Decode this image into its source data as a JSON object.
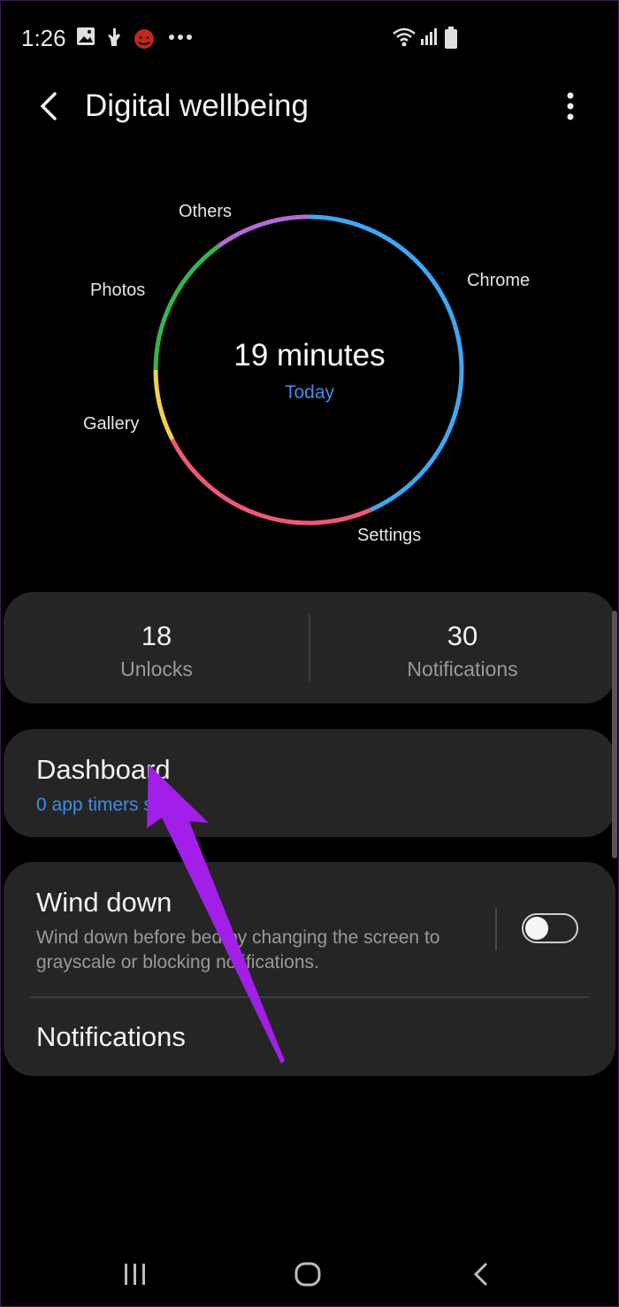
{
  "status_bar": {
    "time": "1:26",
    "icons": [
      "gallery-icon",
      "hand-icon",
      "halloween-icon",
      "more-dots-icon",
      "wifi-icon",
      "signal-icon",
      "battery-icon"
    ]
  },
  "app_bar": {
    "title": "Digital wellbeing",
    "back_icon": "back-arrow-icon",
    "menu_icon": "more-vert-icon"
  },
  "chart_data": {
    "type": "pie",
    "total_text": "19 minutes",
    "period": "Today",
    "labels": [
      "Chrome",
      "Settings",
      "Gallery",
      "Photos",
      "Others"
    ],
    "colors": [
      "#3fa7f2",
      "#ef5876",
      "#f1d14e",
      "#34b54c",
      "#b46ad6"
    ]
  },
  "stats": [
    {
      "value": "18",
      "label": "Unlocks"
    },
    {
      "value": "30",
      "label": "Notifications"
    }
  ],
  "dashboard": {
    "title": "Dashboard",
    "subtitle": "0 app timers set"
  },
  "wind_down": {
    "title": "Wind down",
    "description": "Wind down before bed by changing the screen to grayscale or blocking notifications.",
    "toggle_on": false
  },
  "notifications_item": {
    "label": "Notifications"
  },
  "nav_bar": {
    "icons": [
      "recent-apps-icon",
      "home-icon",
      "back-icon"
    ]
  },
  "annotation": {
    "arrow_color": "#a21fe8"
  }
}
